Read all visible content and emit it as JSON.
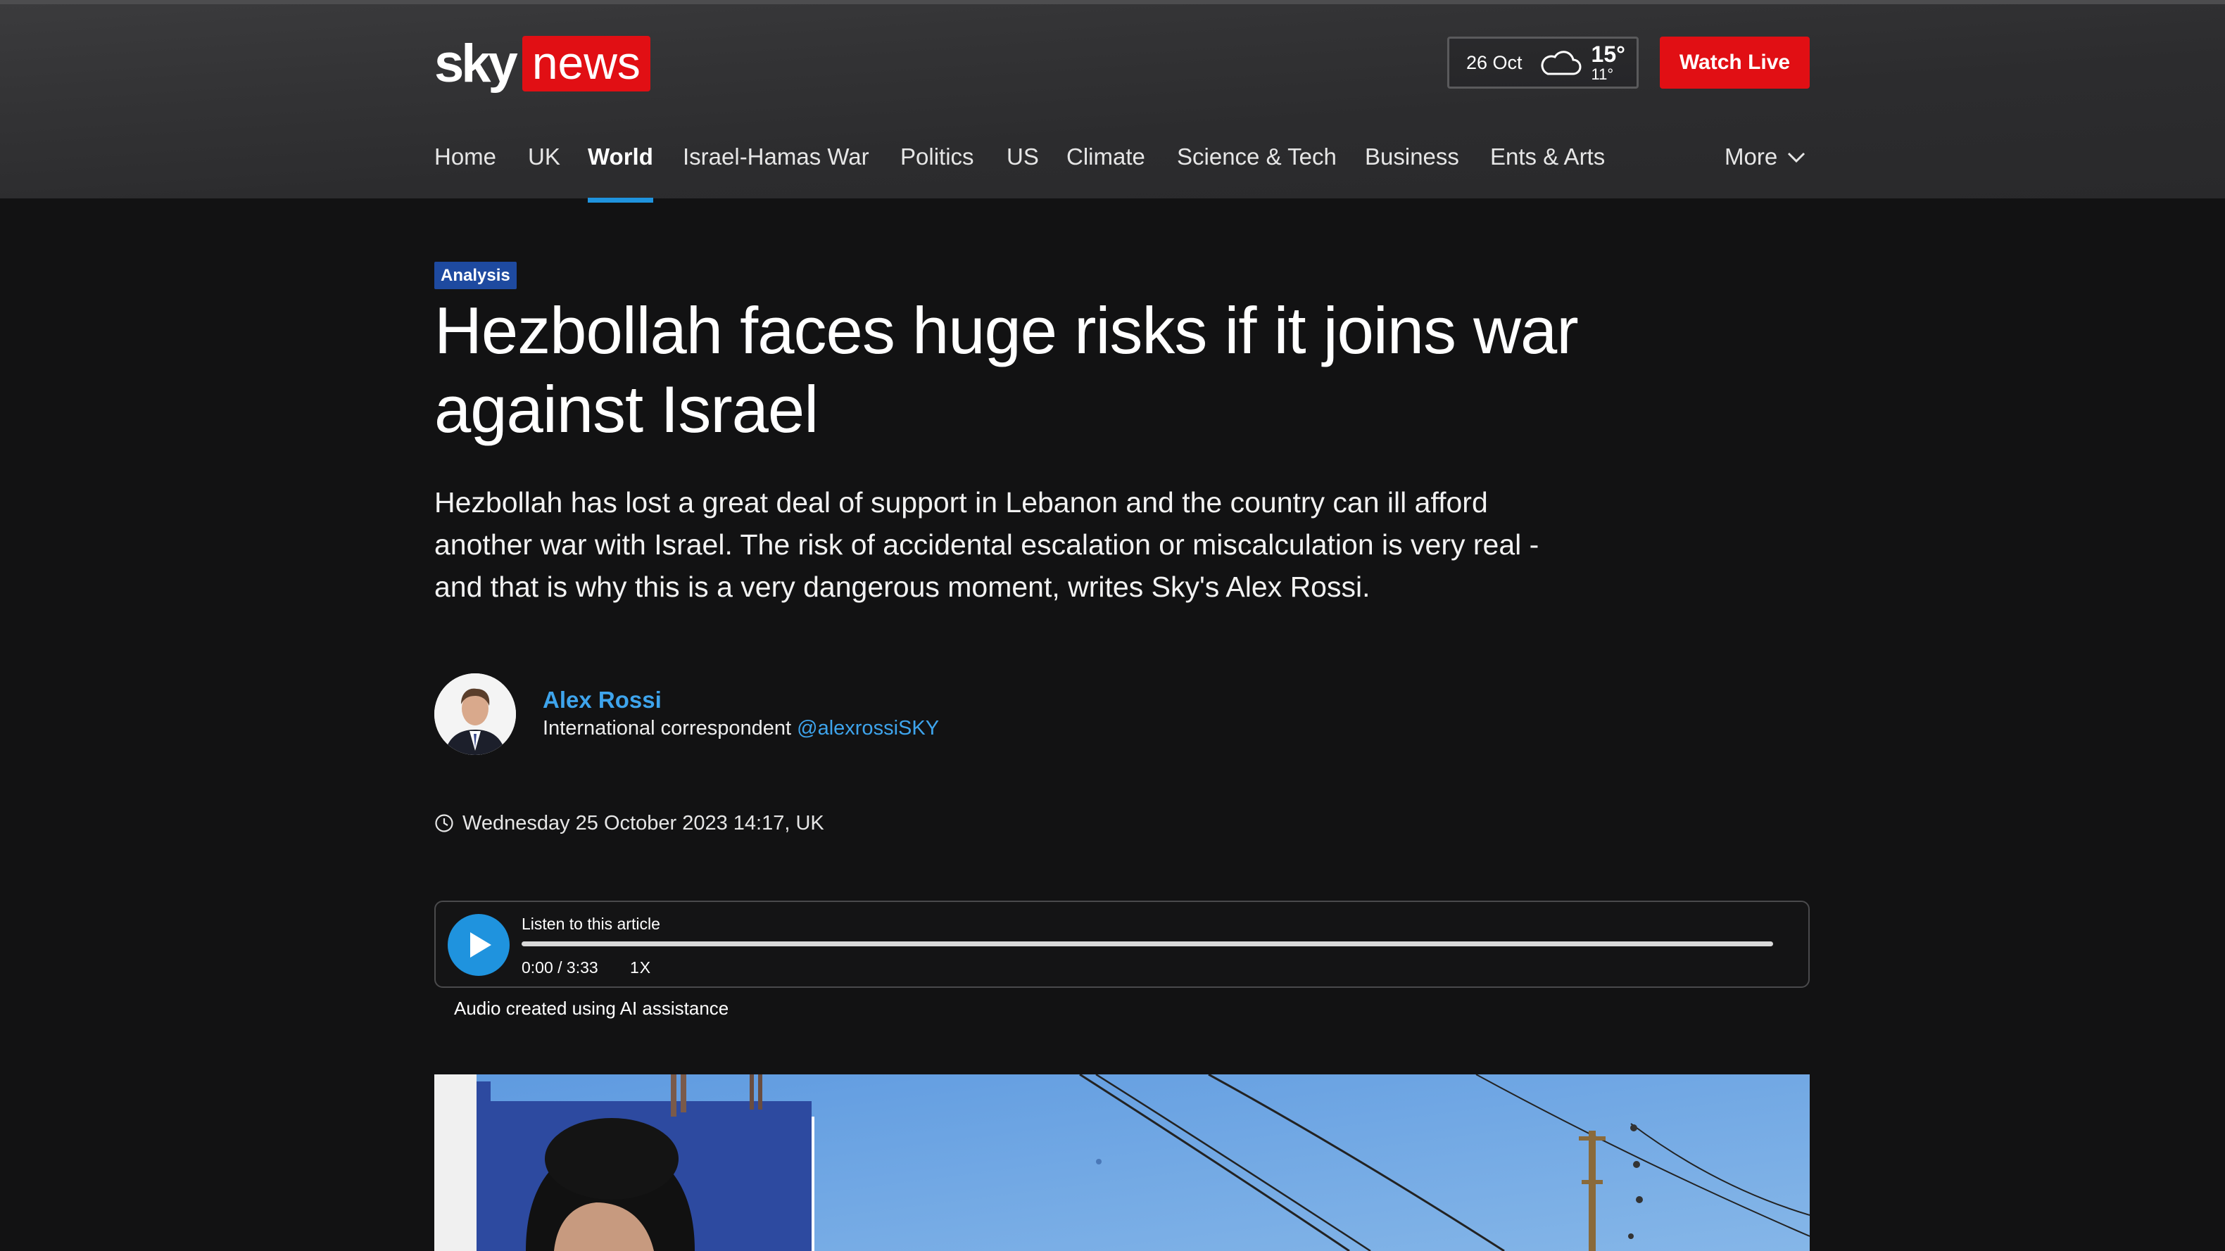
{
  "header": {
    "logo": {
      "sky": "sky",
      "news": "news"
    },
    "weather": {
      "date": "26 Oct",
      "high": "15°",
      "low": "11°",
      "icon": "cloud-icon"
    },
    "watch_live_label": "Watch Live",
    "nav": [
      {
        "label": "Home",
        "active": false
      },
      {
        "label": "UK",
        "active": false
      },
      {
        "label": "World",
        "active": true
      },
      {
        "label": "Israel-Hamas War",
        "active": false
      },
      {
        "label": "Politics",
        "active": false
      },
      {
        "label": "US",
        "active": false
      },
      {
        "label": "Climate",
        "active": false
      },
      {
        "label": "Science & Tech",
        "active": false
      },
      {
        "label": "Business",
        "active": false
      },
      {
        "label": "Ents & Arts",
        "active": false
      }
    ],
    "more_label": "More"
  },
  "article": {
    "badge": "Analysis",
    "headline": "Hezbollah faces huge risks if it joins war against Israel",
    "standfirst": "Hezbollah has lost a great deal of support in Lebanon and the country can ill afford another war with Israel. The risk of accidental escalation or miscalculation is very real - and that is why this is a very dangerous moment, writes Sky's Alex Rossi.",
    "author": {
      "name": "Alex Rossi",
      "role": "International correspondent",
      "handle": "@alexrossiSKY"
    },
    "dateline": "Wednesday 25 October 2023 14:17, UK"
  },
  "audio_player": {
    "label": "Listen to this article",
    "time": "0:00 / 3:33",
    "speed": "1X",
    "progress": 0,
    "ai_note": "Audio created using AI assistance"
  },
  "colors": {
    "brand_red": "#e10f14",
    "accent_blue": "#1f93de",
    "link_blue": "#3ea4ec",
    "badge_blue": "#1e4aa0",
    "background": "#121213"
  }
}
